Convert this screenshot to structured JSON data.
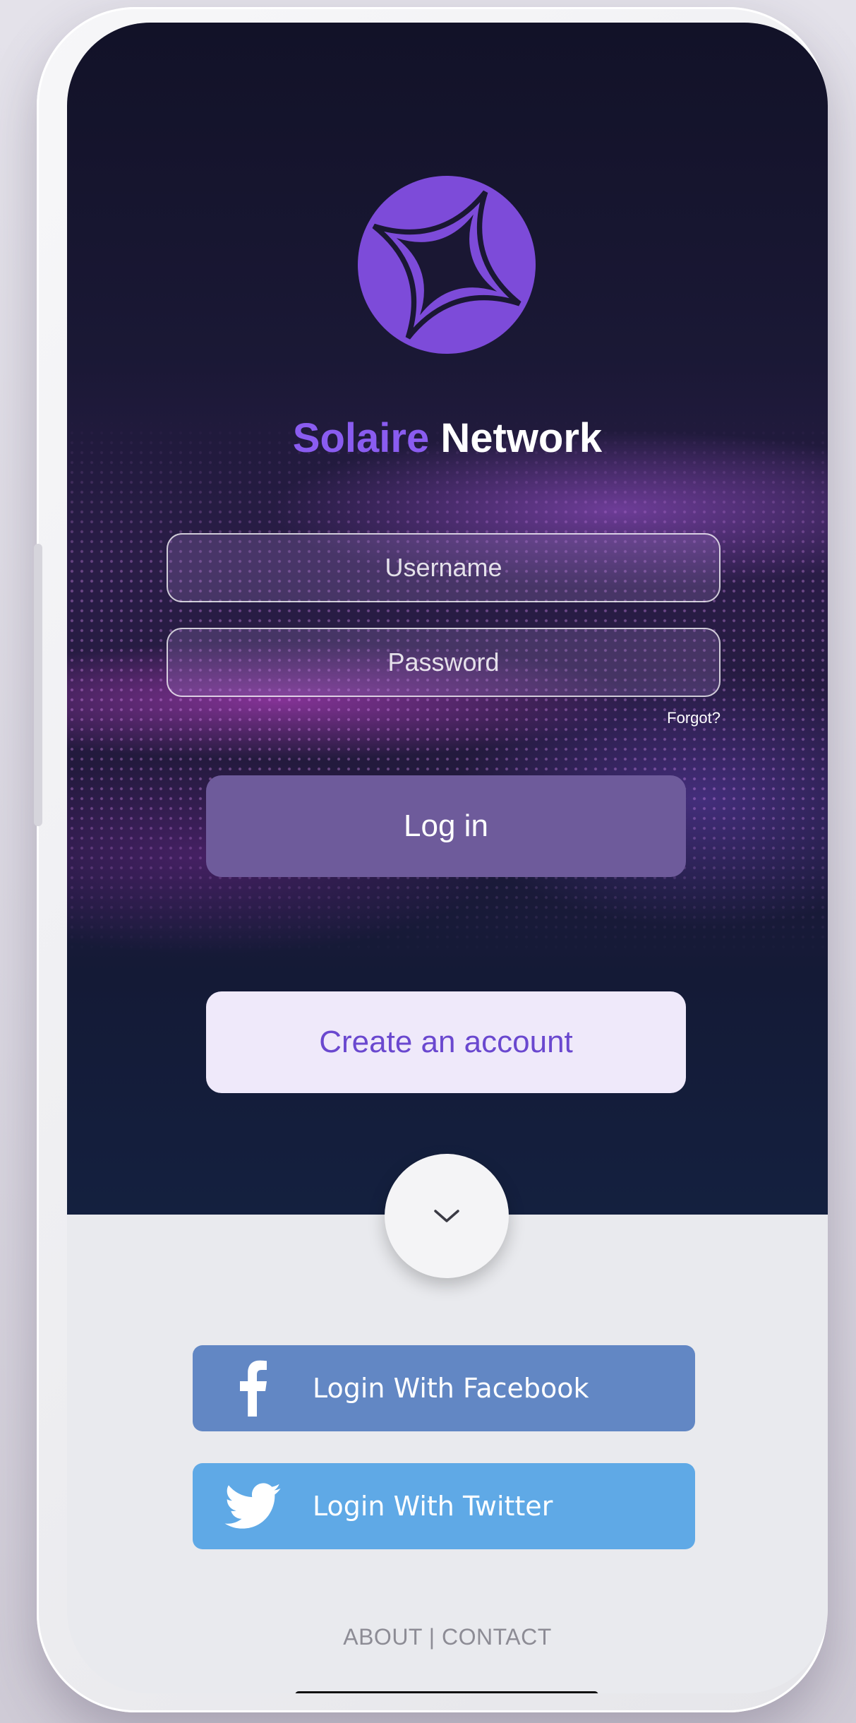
{
  "brand": {
    "name_part1": "Solaire",
    "name_part2": "Network",
    "logo_icon": "four-point-star-in-circle",
    "accent_color": "#8a5cf0"
  },
  "login_form": {
    "username_placeholder": "Username",
    "password_placeholder": "Password",
    "forgot_label": "Forgot?",
    "login_button_label": "Log in"
  },
  "create_account_label": "Create an account",
  "expand_icon": "chevron-down-icon",
  "social_logins": {
    "facebook_label": "Login With Facebook",
    "facebook_color": "#6287c4",
    "twitter_label": "Login With Twitter",
    "twitter_color": "#5fa9e6"
  },
  "footer": {
    "about_label": "ABOUT",
    "separator": "|",
    "contact_label": "CONTACT"
  }
}
